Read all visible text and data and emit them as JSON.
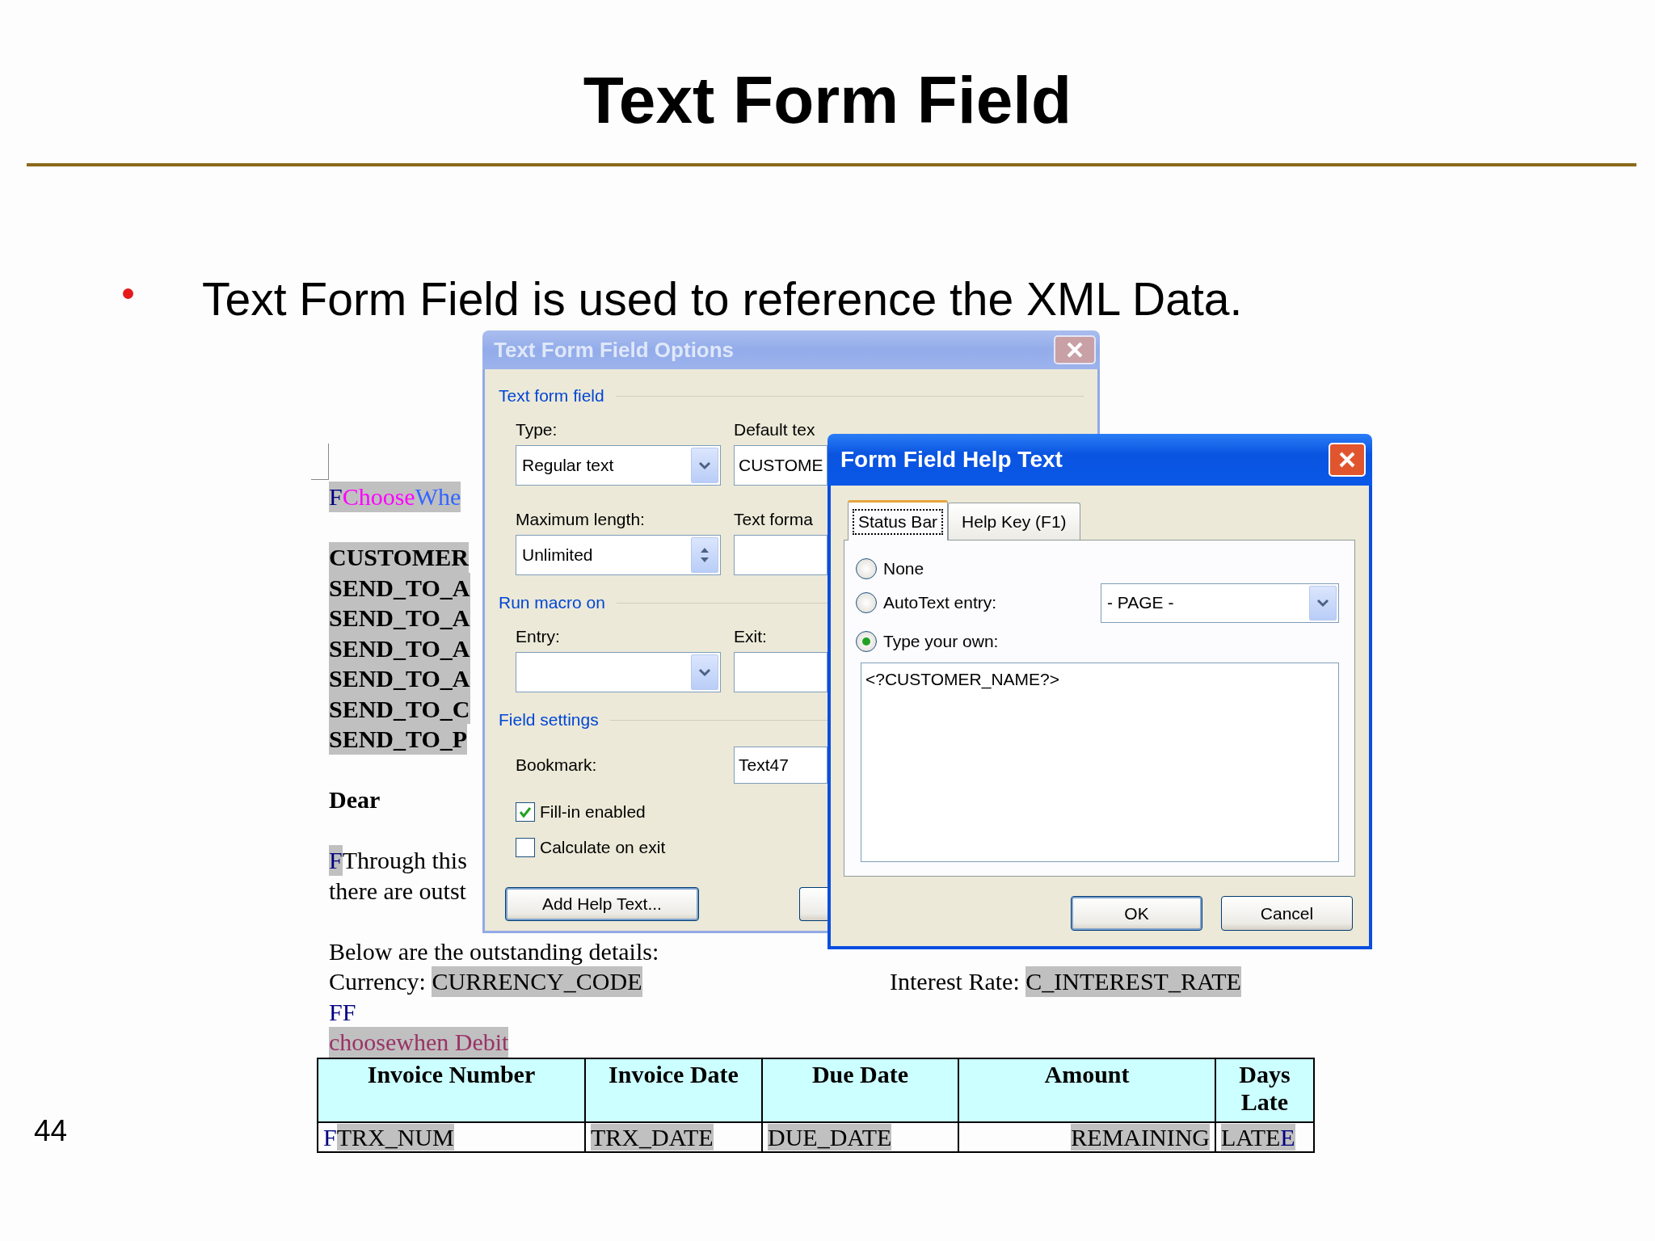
{
  "slide": {
    "title": "Text Form Field",
    "bullets": [
      "Text Form Field is used to reference the XML Data."
    ],
    "page_number": "44"
  },
  "document": {
    "paragraphs": [
      {
        "bold": false,
        "lines": [
          {
            "segments": [
              {
                "text": "F",
                "color": "#000080",
                "highlighted": true
              },
              {
                "text": "Choose",
                "color": "#ff00ff",
                "highlighted": true
              },
              {
                "text": "Whe",
                "color": "#3366ff",
                "highlighted": true
              }
            ]
          }
        ]
      },
      {
        "bold": true,
        "lines": [
          {
            "segments": [
              {
                "text": "CUSTOMER",
                "color": "#000000",
                "highlighted": true
              }
            ]
          },
          {
            "segments": [
              {
                "text": "SEND_TO_A",
                "color": "#000000",
                "highlighted": true
              }
            ]
          },
          {
            "segments": [
              {
                "text": "SEND_TO_A",
                "color": "#000000",
                "highlighted": true
              }
            ]
          },
          {
            "segments": [
              {
                "text": "SEND_TO_A",
                "color": "#000000",
                "highlighted": true
              }
            ]
          },
          {
            "segments": [
              {
                "text": "SEND_TO_A",
                "color": "#000000",
                "highlighted": true
              }
            ]
          },
          {
            "segments": [
              {
                "text": "SEND_TO_C",
                "color": "#000000",
                "highlighted": true
              }
            ]
          },
          {
            "segments": [
              {
                "text": "SEND_TO_P",
                "color": "#000000",
                "highlighted": true
              }
            ]
          }
        ]
      },
      {
        "bold": true,
        "lines": [
          {
            "segments": [
              {
                "text": "Dear",
                "color": "#000000",
                "highlighted": false
              }
            ]
          }
        ]
      },
      {
        "bold": false,
        "lines": [
          {
            "segments": [
              {
                "text": "F",
                "color": "#000080",
                "highlighted": true
              },
              {
                "text": "Through this",
                "color": "#000000",
                "highlighted": false
              }
            ]
          },
          {
            "segments": [
              {
                "text": "there are outst",
                "color": "#000000",
                "highlighted": false
              }
            ]
          }
        ]
      },
      {
        "bold": false,
        "lines": [
          {
            "segments": [
              {
                "text": "Below are the outstanding details:",
                "color": "#000000",
                "highlighted": false
              }
            ]
          },
          {
            "segments": [
              {
                "text": "Currency: ",
                "color": "#000000",
                "highlighted": false
              },
              {
                "text": "CURRENCY_CODE",
                "color": "#000000",
                "highlighted": true
              }
            ],
            "after_tab": [
              {
                "text": "Interest Rate: ",
                "color": "#000000",
                "highlighted": false
              },
              {
                "text": "C_INTEREST_RATE",
                "color": "#000000",
                "highlighted": true
              }
            ]
          },
          {
            "segments": [
              {
                "text": "FF",
                "color": "#000080",
                "highlighted": false
              }
            ]
          },
          {
            "segments": [
              {
                "text": "choose",
                "color": "#993366",
                "highlighted": true
              },
              {
                "text": "when Debit",
                "color": "#993366",
                "highlighted": true
              }
            ]
          }
        ]
      }
    ]
  },
  "table": {
    "columns": [
      "Invoice Number",
      "Invoice Date",
      "Due Date",
      "Amount",
      "Days Late"
    ],
    "rows": [
      [
        [
          {
            "text": "F",
            "color": "#000080",
            "highlighted": false
          },
          {
            "text": "TRX_NUM",
            "color": "#000000",
            "highlighted": true
          }
        ],
        [
          {
            "text": "TRX_DATE",
            "color": "#000000",
            "highlighted": true
          }
        ],
        [
          {
            "text": "DUE_DATE",
            "color": "#000000",
            "highlighted": true
          }
        ],
        [
          {
            "text": "REMAINING",
            "color": "#000000",
            "highlighted": true
          }
        ],
        [
          {
            "text": "LATE",
            "color": "#000000",
            "highlighted": true
          },
          {
            "text": "E",
            "color": "#000080",
            "highlighted": true
          }
        ]
      ]
    ]
  },
  "options_dialog": {
    "title": "Text Form Field Options",
    "active": false,
    "sections": [
      {
        "heading": "Text form field",
        "rows": [
          {
            "cells": [
              {
                "label": "Type:",
                "kind": "dropdown",
                "value": "Regular text"
              },
              {
                "label": "Default tex",
                "kind": "text",
                "value": "CUSTOME"
              }
            ]
          },
          {
            "cells": [
              {
                "label": "Maximum length:",
                "kind": "spinner",
                "value": "Unlimited"
              },
              {
                "label": "Text forma",
                "kind": "text"
              }
            ]
          }
        ]
      },
      {
        "heading": "Run macro on",
        "rows": [
          {
            "cells": [
              {
                "label": "Entry:",
                "kind": "dropdown"
              },
              {
                "label": "Exit:",
                "kind": "text"
              }
            ]
          }
        ]
      },
      {
        "heading": "Field settings"
      }
    ],
    "bookmark": {
      "label": "Bookmark:",
      "value": "Text47"
    },
    "checkboxes": [
      {
        "label": "Fill-in enabled",
        "checked": true
      },
      {
        "label": "Calculate on exit",
        "checked": false
      }
    ],
    "buttons": [
      "Add Help Text..."
    ]
  },
  "help_dialog": {
    "title": "Form Field Help Text",
    "active": true,
    "tabs": [
      {
        "label": "Status Bar",
        "selected": true
      },
      {
        "label": "Help Key (F1)",
        "selected": false
      }
    ],
    "options": [
      {
        "label": "None",
        "kind": "plain",
        "selected": false
      },
      {
        "label": "AutoText entry:",
        "kind": "autotext",
        "selected": false
      },
      {
        "label": "Type your own:",
        "kind": "plain",
        "selected": true
      }
    ],
    "autotext_value": "- PAGE -",
    "help_text": "<?CUSTOMER_NAME?>",
    "buttons": [
      "OK",
      "Cancel"
    ]
  }
}
